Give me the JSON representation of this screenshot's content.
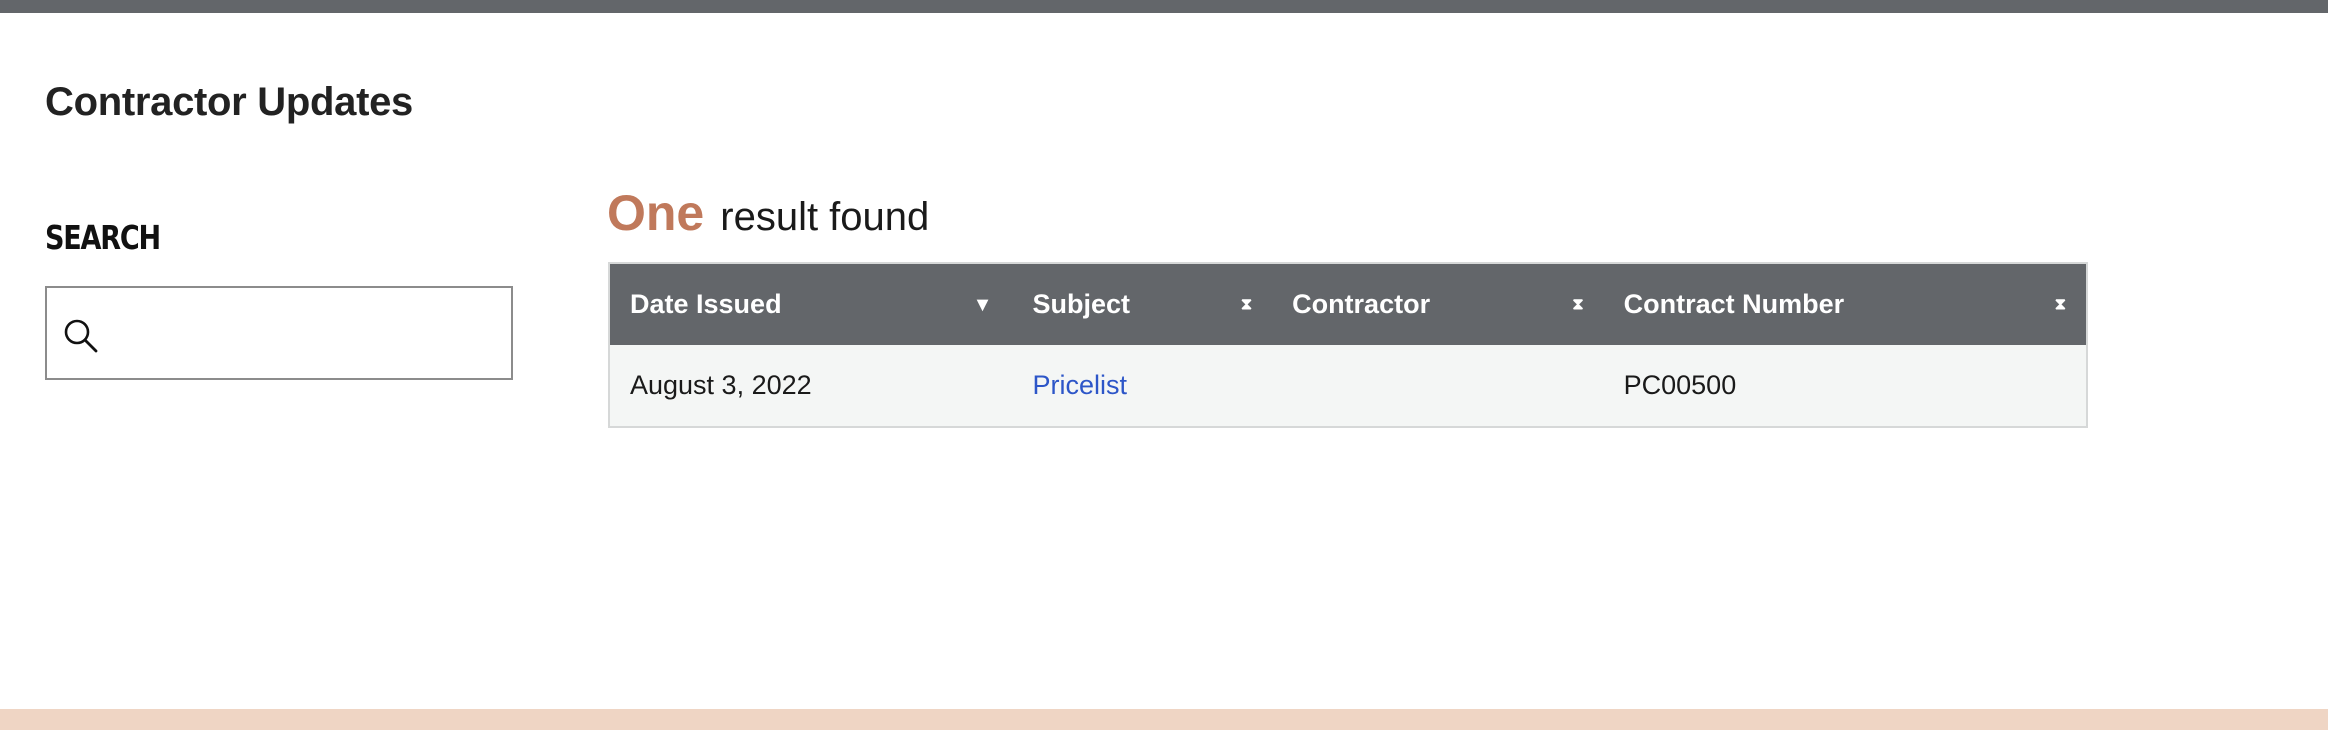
{
  "page": {
    "title": "Contractor Updates"
  },
  "search": {
    "heading": "SEARCH",
    "value": "",
    "placeholder": ""
  },
  "results": {
    "count_label": "One",
    "text": "result found"
  },
  "table": {
    "columns": [
      {
        "label": "Date Issued",
        "sort_icon": "sort-descending-icon",
        "sort_glyph": "▼"
      },
      {
        "label": "Subject",
        "sort_icon": "sort-unsorted-icon",
        "sort_glyph": "⧗"
      },
      {
        "label": "Contractor",
        "sort_icon": "sort-unsorted-icon",
        "sort_glyph": "⧗"
      },
      {
        "label": "Contract Number",
        "sort_icon": "sort-unsorted-icon",
        "sort_glyph": "⧗"
      }
    ],
    "rows": [
      {
        "date_issued": "August 3, 2022",
        "subject": "Pricelist",
        "contractor": "",
        "contract_number": "PC00500"
      }
    ]
  },
  "colors": {
    "header_bar": "#63666a",
    "accent_count": "#c0795b",
    "link": "#2d56c8",
    "footer_band": "#efd5c4",
    "row_bg": "#f4f6f5"
  }
}
